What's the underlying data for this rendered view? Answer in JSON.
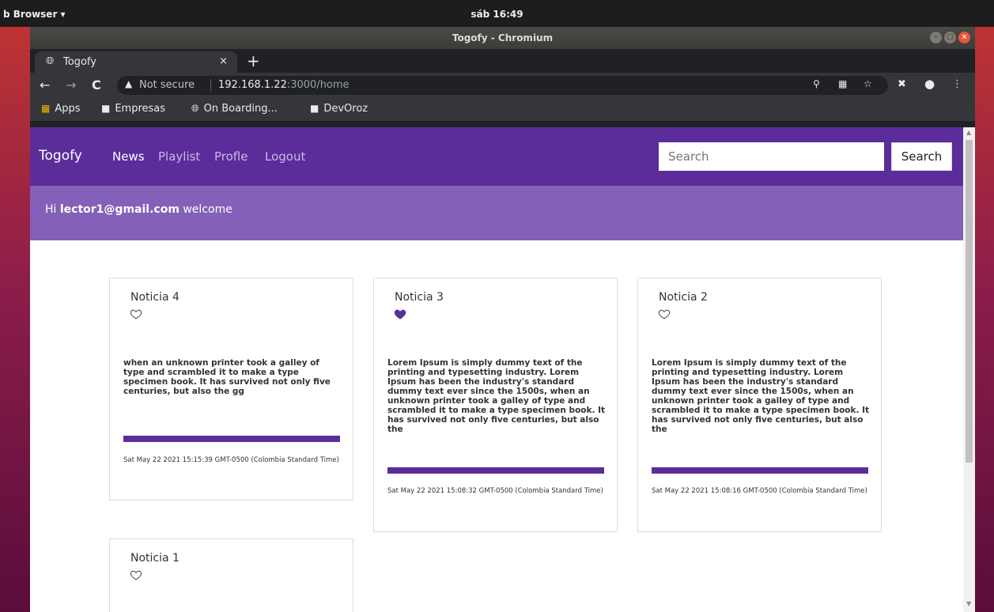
{
  "desktop": {
    "app_menu": "b Browser ▾",
    "clock": "sáb 16:49"
  },
  "window": {
    "title": "Togofy - Chromium"
  },
  "tab": {
    "title": "Togofy",
    "close": "×",
    "new_tab": "+"
  },
  "omnibox": {
    "security_label": "Not secure",
    "url_host": "192.168.1.22",
    "url_rest": ":3000/home"
  },
  "bookmarks": [
    {
      "label": "Apps",
      "icon": "apps-grid-icon"
    },
    {
      "label": "Empresas",
      "icon": "folder-icon"
    },
    {
      "label": "On Boarding...",
      "icon": "globe-icon"
    },
    {
      "label": "DevOroz",
      "icon": "folder-icon"
    }
  ],
  "navbar": {
    "brand": "Togofy",
    "links": [
      "News",
      "Playlist",
      "Profle",
      "Logout"
    ],
    "active_link": "News",
    "search_placeholder": "Search",
    "search_button": "Search"
  },
  "welcome": {
    "greeting": "Hi",
    "user": "lector1@gmail.com",
    "suffix": "welcome"
  },
  "colors": {
    "primary": "#5b2d9b",
    "welcome_bg": "#8460b8"
  },
  "cards": [
    {
      "title": "Noticia 4",
      "liked": false,
      "body": "when an unknown printer took a galley of type and scrambled it to make a type specimen book. It has survived not only five centuries, but also the gg",
      "date": "Sat May 22 2021 15:15:39 GMT-0500 (Colombia Standard Time)"
    },
    {
      "title": "Noticia 3",
      "liked": true,
      "body": "Lorem Ipsum is simply dummy text of the printing and typesetting industry. Lorem Ipsum has been the industry's standard dummy text ever since the 1500s, when an unknown printer took a galley of type and scrambled it to make a type specimen book. It has survived not only five centuries, but also the",
      "date": "Sat May 22 2021 15:08:32 GMT-0500 (Colombia Standard Time)"
    },
    {
      "title": "Noticia 2",
      "liked": false,
      "body": "Lorem Ipsum is simply dummy text of the printing and typesetting industry. Lorem Ipsum has been the industry's standard dummy text ever since the 1500s, when an unknown printer took a galley of type and scrambled it to make a type specimen book. It has survived not only five centuries, but also the",
      "date": "Sat May 22 2021 15:08:16 GMT-0500 (Colombia Standard Time)"
    },
    {
      "title": "Noticia 1",
      "liked": false,
      "body": "",
      "date": ""
    }
  ]
}
